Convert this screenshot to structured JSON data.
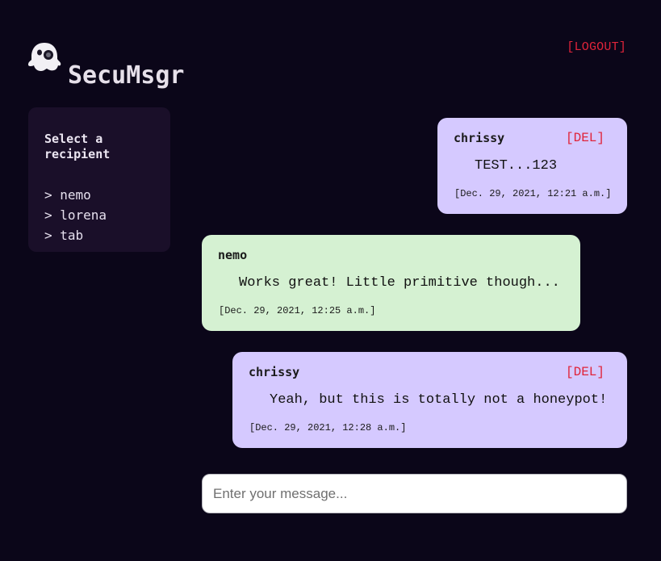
{
  "header": {
    "logout_label": "[LOGOUT]",
    "app_title": "SecuMsgr",
    "logo_icon": "ghost-icon"
  },
  "sidebar": {
    "title": "Select a recipient",
    "recipients": [
      {
        "label": "> nemo"
      },
      {
        "label": "> lorena"
      },
      {
        "label": "> tab"
      }
    ]
  },
  "messages": [
    {
      "sender": "chrissy",
      "text": "TEST...123",
      "timestamp": "[Dec. 29, 2021, 12:21 a.m.]",
      "delete_label": "[DEL]",
      "own": true
    },
    {
      "sender": "nemo",
      "text": "Works great! Little primitive though...",
      "timestamp": "[Dec. 29, 2021, 12:25 a.m.]",
      "own": false
    },
    {
      "sender": "chrissy",
      "text": "Yeah, but this is totally not a honeypot!",
      "timestamp": "[Dec. 29, 2021, 12:28 a.m.]",
      "delete_label": "[DEL]",
      "own": true
    }
  ],
  "composer": {
    "value": "",
    "placeholder": "Enter your message..."
  },
  "colors": {
    "background": "#0b0619",
    "sidebar": "#1a0f29",
    "own_message": "#d5c9ff",
    "other_message": "#d5f1d2",
    "danger": "#e0243a"
  }
}
